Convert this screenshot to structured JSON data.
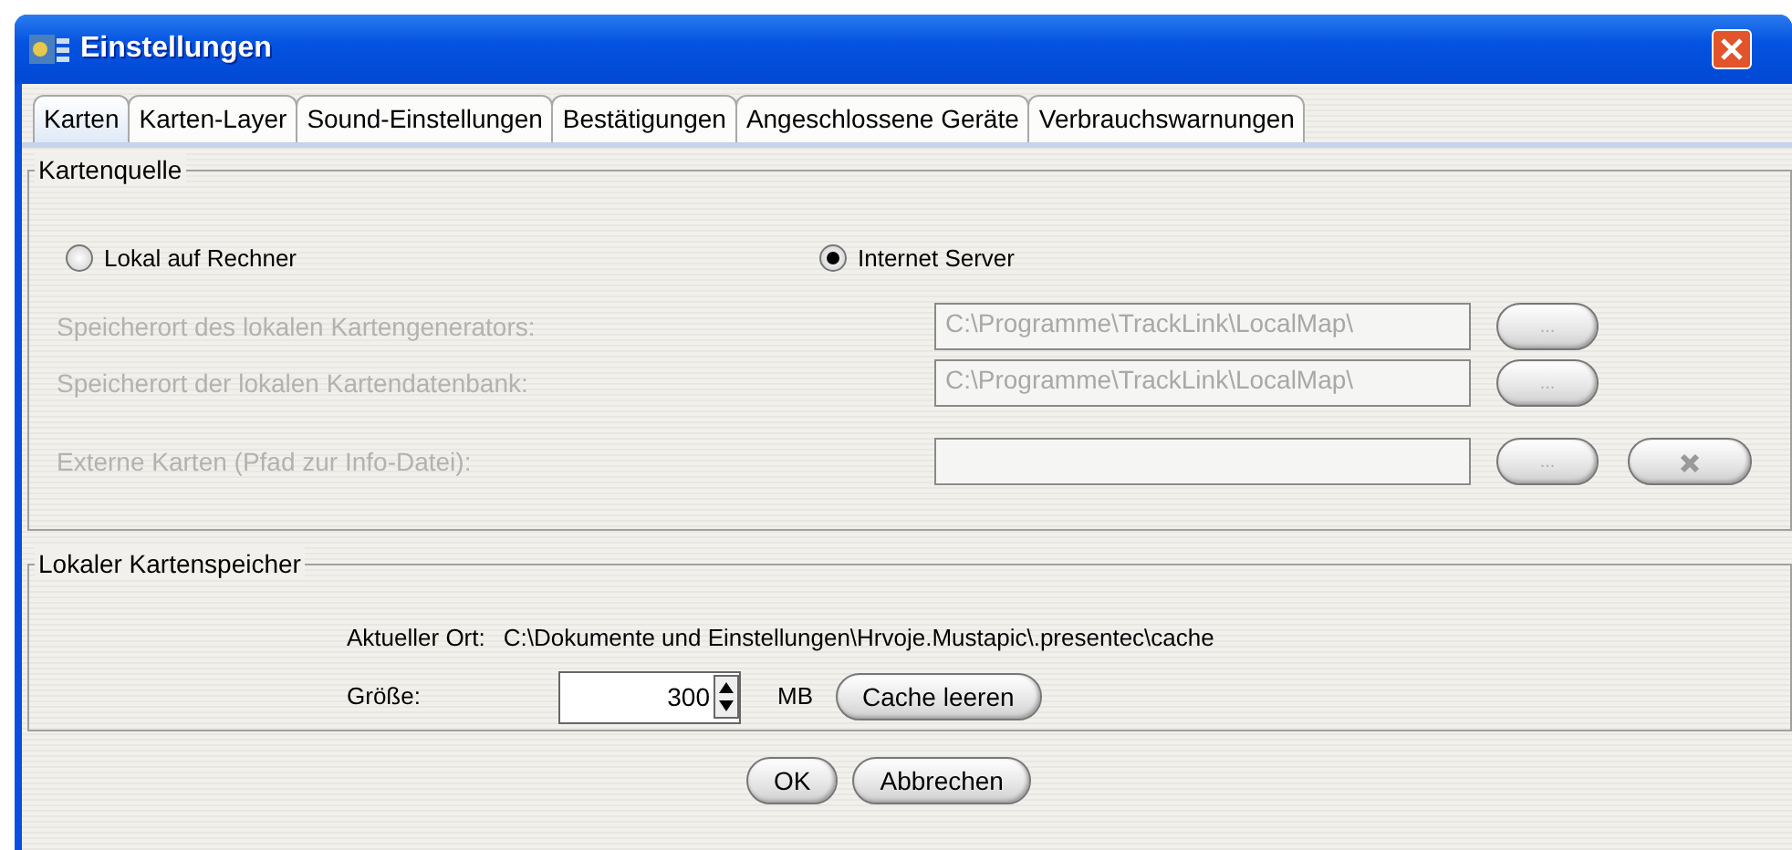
{
  "window": {
    "title": "Einstellungen"
  },
  "tabs": [
    {
      "label": "Karten",
      "selected": true
    },
    {
      "label": "Karten-Layer",
      "selected": false
    },
    {
      "label": "Sound-Einstellungen",
      "selected": false
    },
    {
      "label": "Bestätigungen",
      "selected": false
    },
    {
      "label": "Angeschlossene Geräte",
      "selected": false
    },
    {
      "label": "Verbrauchswarnungen",
      "selected": false
    }
  ],
  "kartenquelle": {
    "title": "Kartenquelle",
    "radios": [
      {
        "label": "Lokal auf Rechner",
        "selected": false
      },
      {
        "label": "Internet Server",
        "selected": true
      }
    ],
    "rows": [
      {
        "label": "Speicherort des lokalen Kartengenerators:",
        "value": "C:\\Programme\\TrackLink\\LocalMap\\",
        "disabled": true,
        "browse": "...",
        "clear": false
      },
      {
        "label": "Speicherort der lokalen Kartendatenbank:",
        "value": "C:\\Programme\\TrackLink\\LocalMap\\",
        "disabled": true,
        "browse": "...",
        "clear": false
      },
      {
        "label": "Externe Karten (Pfad zur Info-Datei):",
        "disabled": true,
        "browse": "...",
        "clear": true
      }
    ]
  },
  "cache": {
    "title": "Lokaler Kartenspeicher",
    "location_label": "Aktueller Ort:",
    "location": "C:\\Dokumente und Einstellungen\\Hrvoje.Mustapic\\.presentec\\cache",
    "size_label": "Größe:",
    "size": "300",
    "unit": "MB",
    "clear_button": "Cache leeren"
  },
  "buttons": [
    "OK",
    "Abbrechen"
  ]
}
